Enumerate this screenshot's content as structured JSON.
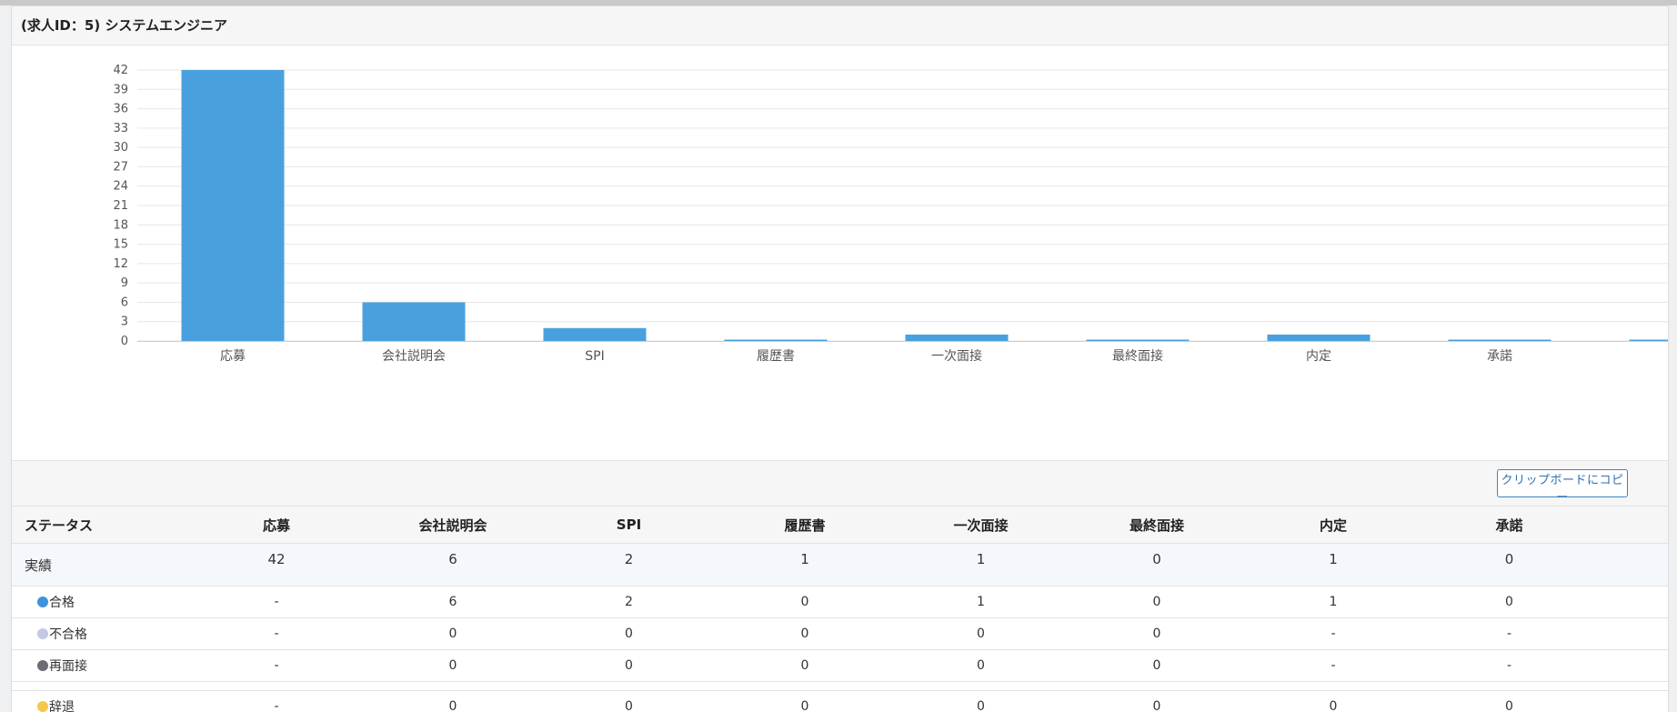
{
  "panel": {
    "title": "(求人ID：5) システムエンジニア"
  },
  "chart_data": {
    "type": "bar",
    "categories": [
      "応募",
      "会社説明会",
      "SPI",
      "履歴書",
      "一次面接",
      "最終面接",
      "内定",
      "承諾",
      ""
    ],
    "values": [
      42,
      6,
      2,
      0,
      1,
      0,
      1,
      0,
      0
    ],
    "y_ticks": [
      "0",
      "3",
      "6",
      "9",
      "12",
      "15",
      "18",
      "21",
      "24",
      "27",
      "30",
      "33",
      "36",
      "39",
      "42"
    ],
    "ylim": [
      0,
      42
    ],
    "grid": true,
    "bar_color": "#4aa0de",
    "legend": "none",
    "title": "",
    "xlabel": "",
    "ylabel": ""
  },
  "toolbar": {
    "copy_label": "クリップボードにコピー"
  },
  "table": {
    "headers": [
      "ステータス",
      "応募",
      "会社説明会",
      "SPI",
      "履歴書",
      "一次面接",
      "最終面接",
      "内定",
      "承諾"
    ],
    "actual": {
      "label": "実績",
      "values": [
        "42",
        "6",
        "2",
        "1",
        "1",
        "0",
        "1",
        "0"
      ]
    },
    "pass": {
      "label": "合格",
      "dot_color": "#3f93dc",
      "values": [
        "-",
        "6",
        "2",
        "0",
        "1",
        "0",
        "1",
        "0"
      ]
    },
    "fail": {
      "label": "不合格",
      "dot_color": "#c3c9e3",
      "values": [
        "-",
        "0",
        "0",
        "0",
        "0",
        "0",
        "-",
        "-"
      ]
    },
    "reinterview": {
      "label": "再面接",
      "dot_color": "#6b6c75",
      "values": [
        "-",
        "0",
        "0",
        "0",
        "0",
        "0",
        "-",
        "-"
      ]
    },
    "withdraw": {
      "label": "辞退",
      "dot_color": "#f5c84c",
      "values": [
        "-",
        "0",
        "0",
        "0",
        "0",
        "0",
        "0",
        "0"
      ]
    }
  }
}
